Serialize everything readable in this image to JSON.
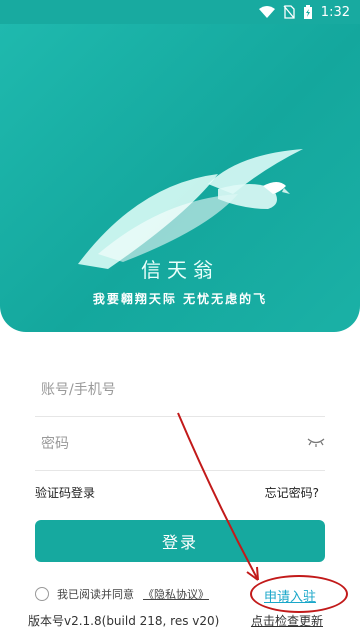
{
  "status_bar": {
    "time": "1:32"
  },
  "hero": {
    "brand_name": "信天翁",
    "slogan": "我要翱翔天际 无忧无虑的飞"
  },
  "login": {
    "account_placeholder": "账号/手机号",
    "password_placeholder": "密码",
    "sms_login_label": "验证码登录",
    "forgot_password_label": "忘记密码?",
    "login_button_label": "登录"
  },
  "agreement": {
    "agree_text": "我已阅读并同意",
    "privacy_link": "《隐私协议》",
    "apply_link": "申请入驻"
  },
  "footer": {
    "version_text": "版本号v2.1.8(build 218, res v20)",
    "update_link": "点击检查更新"
  },
  "colors": {
    "brand": "#16a99f",
    "annotation": "#c21a1a",
    "link": "#1aa7c9"
  }
}
